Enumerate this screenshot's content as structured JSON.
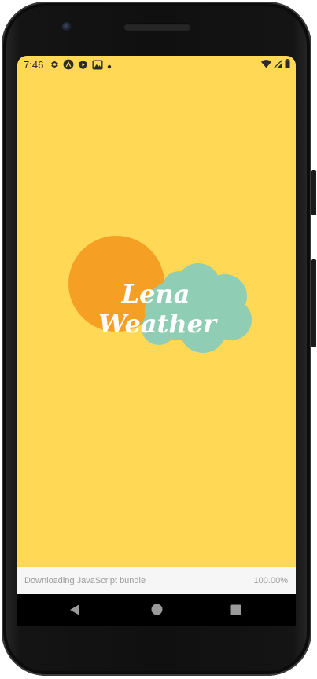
{
  "status_bar": {
    "time": "7:46",
    "left_icons": [
      "settings-icon",
      "app-logo-icon",
      "play-protect-icon",
      "photo-icon",
      "dot-icon"
    ],
    "right_icons": [
      "wifi-icon",
      "signal-icon",
      "battery-icon"
    ]
  },
  "splash": {
    "background_color": "#ffd956",
    "sun_color": "#f5a024",
    "cloud_color": "#8fcdb4",
    "logo_line1": "Lena",
    "logo_line2": "Weather"
  },
  "loading": {
    "message": "Downloading JavaScript bundle",
    "percent_text": "100.00%"
  },
  "nav": {
    "back": "back-icon",
    "home": "home-icon",
    "recents": "recents-icon"
  }
}
